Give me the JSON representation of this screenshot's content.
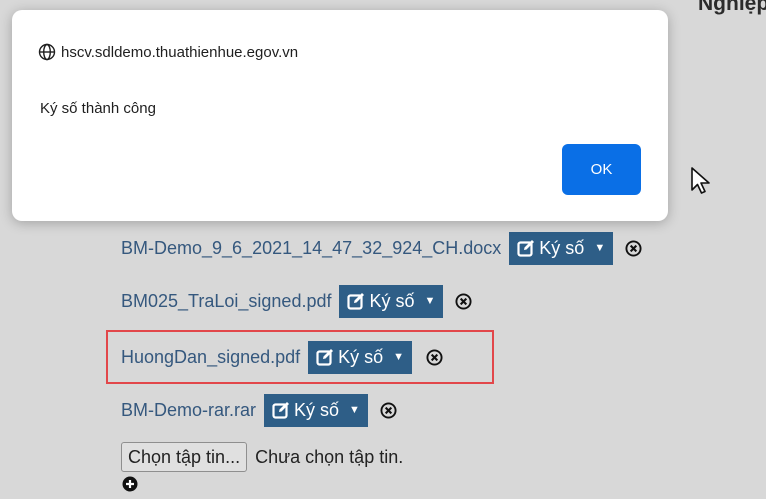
{
  "page": {
    "header_partial": "Nghiệp",
    "files": [
      {
        "name": "BM-Demo_9_6_2021_14_47_32_924_CH.docx",
        "sign_label": "Ký số"
      },
      {
        "name": "BM025_TraLoi_signed.pdf",
        "sign_label": "Ký số"
      },
      {
        "name": "HuongDan_signed.pdf",
        "sign_label": "Ký số"
      },
      {
        "name": "BM-Demo-rar.rar",
        "sign_label": "Ký số"
      }
    ],
    "choose_file_label": "Chọn tập tin...",
    "no_file_text": "Chưa chọn tập tin."
  },
  "dialog": {
    "origin": "hscv.sdldemo.thuathienhue.egov.vn",
    "message": "Ký số thành công",
    "ok_label": "OK"
  },
  "colors": {
    "link": "#35587e",
    "sign_button": "#2e5e87",
    "highlight": "#e2474a",
    "ok_button": "#0a6fe6"
  }
}
